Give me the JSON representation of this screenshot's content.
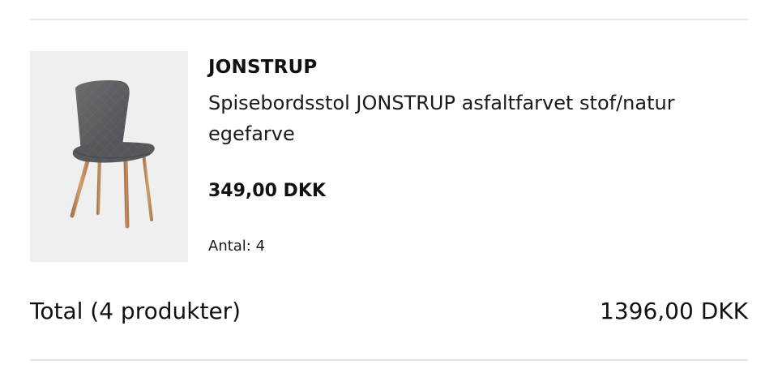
{
  "product": {
    "image_icon": "chair-product-image",
    "brand": "JONSTRUP",
    "title": "Spisebordsstol JONSTRUP asfaltfarvet stof/natur egefarve",
    "price": "349,00 DKK",
    "quantity_label": "Antal:",
    "quantity_value": "4"
  },
  "summary": {
    "total_label": "Total (4 produkter)",
    "total_value": "1396,00 DKK"
  },
  "colors": {
    "divider": "#dfe6ec",
    "image_background": "#efefef",
    "fabric": "#5b5d61",
    "wood": "#c38f5c"
  }
}
